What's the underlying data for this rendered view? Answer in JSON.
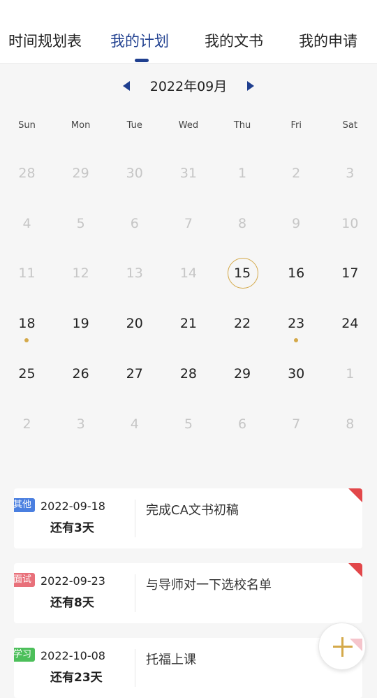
{
  "tabs": [
    {
      "label": "时间规划表",
      "active": false
    },
    {
      "label": "我的计划",
      "active": true
    },
    {
      "label": "我的文书",
      "active": false
    },
    {
      "label": "我的申请",
      "active": false
    }
  ],
  "calendar": {
    "month_label": "2022年09月",
    "weekdays": [
      "Sun",
      "Mon",
      "Tue",
      "Wed",
      "Thu",
      "Fri",
      "Sat"
    ],
    "weeks": [
      [
        {
          "d": "28",
          "m": true
        },
        {
          "d": "29",
          "m": true
        },
        {
          "d": "30",
          "m": true
        },
        {
          "d": "31",
          "m": true
        },
        {
          "d": "1",
          "m": true
        },
        {
          "d": "2",
          "m": true
        },
        {
          "d": "3",
          "m": true
        }
      ],
      [
        {
          "d": "4",
          "m": true
        },
        {
          "d": "5",
          "m": true
        },
        {
          "d": "6",
          "m": true
        },
        {
          "d": "7",
          "m": true
        },
        {
          "d": "8",
          "m": true
        },
        {
          "d": "9",
          "m": true
        },
        {
          "d": "10",
          "m": true
        }
      ],
      [
        {
          "d": "11",
          "m": true
        },
        {
          "d": "12",
          "m": true
        },
        {
          "d": "13",
          "m": true
        },
        {
          "d": "14",
          "m": true
        },
        {
          "d": "15",
          "today": true
        },
        {
          "d": "16"
        },
        {
          "d": "17"
        }
      ],
      [
        {
          "d": "18",
          "event": true
        },
        {
          "d": "19"
        },
        {
          "d": "20"
        },
        {
          "d": "21"
        },
        {
          "d": "22"
        },
        {
          "d": "23",
          "event": true
        },
        {
          "d": "24"
        }
      ],
      [
        {
          "d": "25"
        },
        {
          "d": "26"
        },
        {
          "d": "27"
        },
        {
          "d": "28"
        },
        {
          "d": "29"
        },
        {
          "d": "30"
        },
        {
          "d": "1",
          "m": true
        }
      ],
      [
        {
          "d": "2",
          "m": true
        },
        {
          "d": "3",
          "m": true
        },
        {
          "d": "4",
          "m": true
        },
        {
          "d": "5",
          "m": true
        },
        {
          "d": "6",
          "m": true
        },
        {
          "d": "7",
          "m": true
        },
        {
          "d": "8",
          "m": true
        }
      ]
    ]
  },
  "plans": [
    {
      "badge": "其他",
      "badge_color": "#4a7fe0",
      "date": "2022-09-18",
      "remaining": "还有3天",
      "title": "完成CA文书初稿",
      "flag": true
    },
    {
      "badge": "面试",
      "badge_color": "#e8707a",
      "date": "2022-09-23",
      "remaining": "还有8天",
      "title": "与导师对一下选校名单",
      "flag": true
    },
    {
      "badge": "学习",
      "badge_color": "#4cbf5a",
      "date": "2022-10-08",
      "remaining": "还有23天",
      "title": "托福上课",
      "flag": false
    }
  ],
  "colors": {
    "accent": "#1f3f8f",
    "highlight": "#d4a94a",
    "flag": "#e2474a"
  },
  "fab": {
    "icon": "plus-icon"
  }
}
